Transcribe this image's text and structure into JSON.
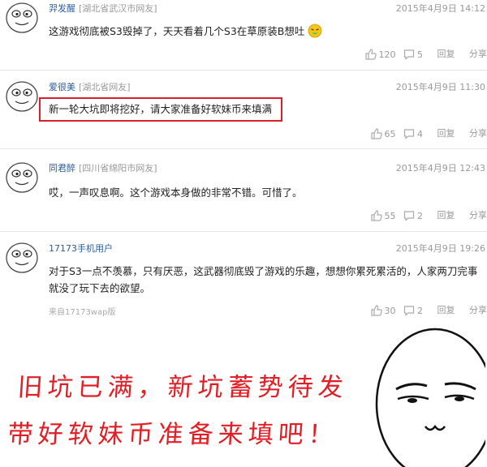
{
  "comments": [
    {
      "username": "羿发醒",
      "location": "[湖北省武汉市网友]",
      "time": "2015年4月9日 14:12",
      "text": "这游戏彻底被S3毁掉了，天天看着几个S3在草原装B想吐",
      "likes": "120",
      "replies": "5",
      "reply_label": "回复",
      "share_label": "分享"
    },
    {
      "username": "爱很美",
      "location": "[湖北省网友]",
      "time": "2015年4月9日 11:30",
      "text": "新一轮大坑即将挖好，请大家准备好软妹币来填满",
      "likes": "65",
      "replies": "4",
      "reply_label": "回复",
      "share_label": "分享"
    },
    {
      "username": "同君醉",
      "location": "[四川省绵阳市网友]",
      "time": "2015年4月9日 12:43",
      "text": "哎，一声叹息啊。这个游戏本身做的非常不错。可惜了。",
      "likes": "55",
      "replies": "2",
      "reply_label": "回复",
      "share_label": "分享"
    },
    {
      "username": "17173手机用户",
      "location": "",
      "time": "2015年4月9日 19:26",
      "text_line1": "对于S3一点不羡慕，只有厌恶，这武器彻底毁了游戏的乐趣，想想你累死累活的，人家两刀完事",
      "text_line2": "就没了玩下去的欲望。",
      "source": "来自17173wap版",
      "likes": "30",
      "replies": "2",
      "reply_label": "回复",
      "share_label": "分享"
    }
  ],
  "caption": {
    "line1": "旧坑已满，新坑蓄势待发",
    "line2": "带好软妹币准备来填吧！"
  },
  "colors": {
    "highlight": "#d81f2a",
    "caption": "#e21d24",
    "username": "#2a5d9e"
  },
  "icons": [
    "avatar-face",
    "thumbs-up-icon",
    "comment-icon",
    "meme-face"
  ]
}
